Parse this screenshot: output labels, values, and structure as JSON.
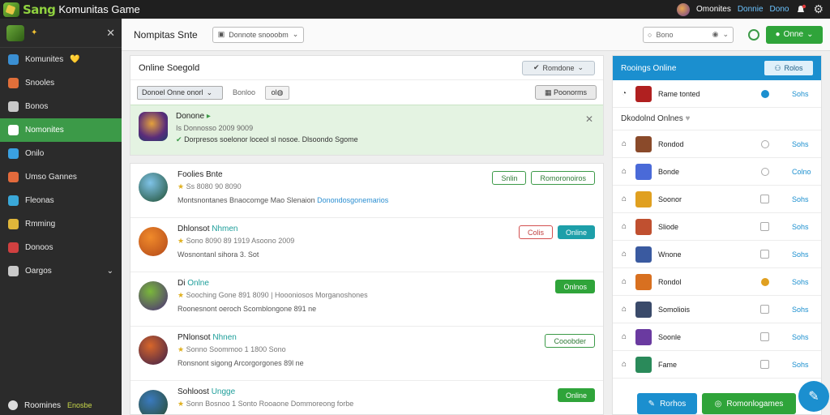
{
  "topbar": {
    "brand": "Sang",
    "title": "Komunitas Game",
    "user_label": "Omonites",
    "link1": "Donnie",
    "link2": "Dono"
  },
  "sidebar": {
    "items": [
      {
        "label": "Komunites",
        "color": "#3a8fd3",
        "badge": "💛"
      },
      {
        "label": "Snooles",
        "color": "#e06f3a"
      },
      {
        "label": "Bonos",
        "color": "#c9c9c9"
      },
      {
        "label": "Nomonites",
        "color": "#ffffff",
        "active": true
      },
      {
        "label": "Onilo",
        "color": "#3aa0e0"
      },
      {
        "label": "Umso Gannes",
        "color": "#e26a3c"
      },
      {
        "label": "Fleonas",
        "color": "#3aa8d8"
      },
      {
        "label": "Rmming",
        "color": "#e0b63a"
      },
      {
        "label": "Donoos",
        "color": "#d04040"
      },
      {
        "label": "Oargos",
        "color": "#c9c9c9",
        "chevron": true
      }
    ],
    "footer_label": "Roomines",
    "footer_sub": "Enosbe"
  },
  "header": {
    "page_title": "Nompitas Snte",
    "crumb": "Donnote snooobm",
    "search_placeholder": "Bono",
    "online_button": "Onne"
  },
  "main": {
    "section_title": "Online Soegold",
    "section_btn": "Romdone",
    "filter_dropdown": "Donoel Onne onorl",
    "filter_label": "Bonloo",
    "small_btn": "ol",
    "right_btn": "Poonorms",
    "notice": {
      "title": "Donone",
      "meta": "Is Donnosso 2009 9009",
      "text": "Dorpresos soelonor loceol sl nosoe. Dlsoondo Sgome"
    },
    "items": [
      {
        "title": "Foolies Bnte",
        "highlight": "",
        "meta": "Ss 8080 90 8090",
        "desc": "Montsnontanes Bnaocomge Mao Slenaion",
        "desc_hl": "Donondosgonemarios",
        "actions": [
          {
            "label": "Snlin",
            "style": "outline-green"
          },
          {
            "label": "Romoronoiros",
            "style": "outline-green"
          }
        ],
        "avatar": [
          "#7fc3e8",
          "#1e4d2f"
        ]
      },
      {
        "title": "Dhlonsot",
        "highlight": "Nhmen",
        "meta": "Sono 8090 89 1919 Asoono 2009",
        "desc": "Wosnontanl sihora 3. Sot",
        "desc_hl": "",
        "actions": [
          {
            "label": "Colis",
            "style": "outline-red"
          },
          {
            "label": "Online",
            "style": "teal"
          }
        ],
        "avatar": [
          "#f08a2a",
          "#b2481a"
        ]
      },
      {
        "title": "Di",
        "highlight": "Onlne",
        "meta": "Sooching Gone 891 8090 | Hoooniosos Morganoshones",
        "desc": "Roonesnont oeroch Scomblongone 891 ne",
        "desc_hl": "",
        "actions": [
          {
            "label": "Onlnos",
            "style": "green"
          }
        ],
        "avatar": [
          "#7ab83a",
          "#4a2a7a"
        ]
      },
      {
        "title": "PNlonsot",
        "highlight": "Nhnen",
        "meta": "Sonno Soommoo 1 1800 Sono",
        "desc": "Ronsnont sigong Arcorgorgones 89l ne",
        "desc_hl": "",
        "actions": [
          {
            "label": "Cooobder",
            "style": "outline-green"
          }
        ],
        "avatar": [
          "#d8662a",
          "#3a1e4a"
        ]
      },
      {
        "title": "Sohloost",
        "highlight": "Ungge",
        "meta": "Sonn Bosnoo 1 Sonto Rooaone Dommoreong forbe",
        "desc": "",
        "desc_hl": "",
        "actions": [
          {
            "label": "Online",
            "style": "green"
          }
        ],
        "avatar": [
          "#3a7abf",
          "#2a4a2a"
        ]
      }
    ]
  },
  "rpanel": {
    "title": "Rooings Online",
    "header_btn": "Rolos",
    "top_row": {
      "name": "Rame tonted",
      "status": "Sohs"
    },
    "sub_title": "Dkodolnd Onlnes",
    "rows": [
      {
        "name": "Rondod",
        "status": "Sohs",
        "img": "#8a4a2a",
        "mark": "dot"
      },
      {
        "name": "Bonde",
        "status": "Colno",
        "img": "#4a6ad8",
        "mark": "dot"
      },
      {
        "name": "Soonor",
        "status": "Sohs",
        "img": "#e0a020",
        "mark": "check"
      },
      {
        "name": "Sliode",
        "status": "Sohs",
        "img": "#c05030",
        "mark": "check"
      },
      {
        "name": "Wnone",
        "status": "Sohs",
        "img": "#3a5aa0",
        "mark": "check"
      },
      {
        "name": "Rondol",
        "status": "Sohs",
        "img": "#d87020",
        "mark": "dot-orange"
      },
      {
        "name": "Somoliois",
        "status": "Sohs",
        "img": "#3a4a6a",
        "mark": "check"
      },
      {
        "name": "Soonle",
        "status": "Sohs",
        "img": "#6a3aa0",
        "mark": "check"
      },
      {
        "name": "Fame",
        "status": "Sohs",
        "img": "#2a8a5a",
        "mark": "check"
      }
    ],
    "footer_btn1": "Rorhos",
    "footer_btn2": "Romonlogames"
  }
}
